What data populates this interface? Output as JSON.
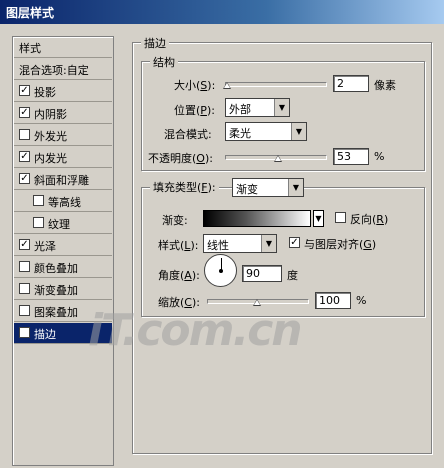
{
  "window": {
    "title": "图层样式"
  },
  "sidebar": {
    "header": "样式",
    "blend_options": "混合选项:自定",
    "items": [
      {
        "label": "投影",
        "checked": true,
        "indent": false,
        "selected": false
      },
      {
        "label": "内阴影",
        "checked": true,
        "indent": false,
        "selected": false
      },
      {
        "label": "外发光",
        "checked": false,
        "indent": false,
        "selected": false
      },
      {
        "label": "内发光",
        "checked": true,
        "indent": false,
        "selected": false
      },
      {
        "label": "斜面和浮雕",
        "checked": true,
        "indent": false,
        "selected": false
      },
      {
        "label": "等高线",
        "checked": false,
        "indent": true,
        "selected": false
      },
      {
        "label": "纹理",
        "checked": false,
        "indent": true,
        "selected": false
      },
      {
        "label": "光泽",
        "checked": true,
        "indent": false,
        "selected": false
      },
      {
        "label": "颜色叠加",
        "checked": false,
        "indent": false,
        "selected": false
      },
      {
        "label": "渐变叠加",
        "checked": false,
        "indent": false,
        "selected": false
      },
      {
        "label": "图案叠加",
        "checked": false,
        "indent": false,
        "selected": false
      },
      {
        "label": "描边",
        "checked": true,
        "indent": false,
        "selected": true
      }
    ],
    "check_mark": "✓"
  },
  "stroke": {
    "title": "描边",
    "structure": {
      "title": "结构",
      "size_label": "大小(",
      "size_key": "S",
      "size_label_end": "):",
      "size_value": "2",
      "size_unit": "像素",
      "size_level": 0.02,
      "position_label": "位置(",
      "position_key": "P",
      "position_label_end": "):",
      "position_value": "外部",
      "blend_label": "混合模式:",
      "blend_value": "柔光",
      "opacity_label": "不透明度(",
      "opacity_key": "O",
      "opacity_label_end": "):",
      "opacity_value": "53",
      "opacity_unit": "%",
      "opacity_level": 0.53
    },
    "fill": {
      "type_label": "填充类型(",
      "type_key": "F",
      "type_label_end": "):",
      "type_value": "渐变",
      "gradient_label": "渐变:",
      "reverse_label": "反向(",
      "reverse_key": "R",
      "reverse_label_end": ")",
      "reverse_checked": false,
      "style_label": "样式(",
      "style_key": "L",
      "style_label_end": "):",
      "style_value": "线性",
      "align_label": "与图层对齐(",
      "align_key": "G",
      "align_label_end": ")",
      "align_checked": true,
      "angle_label": "角度(",
      "angle_key": "A",
      "angle_label_end": "):",
      "angle_value": "90",
      "angle_unit": "度",
      "scale_label": "缩放(",
      "scale_key": "C",
      "scale_label_end": "):",
      "scale_value": "100",
      "scale_unit": "%",
      "scale_level": 0.5
    }
  },
  "watermark": "iT.com.cn"
}
